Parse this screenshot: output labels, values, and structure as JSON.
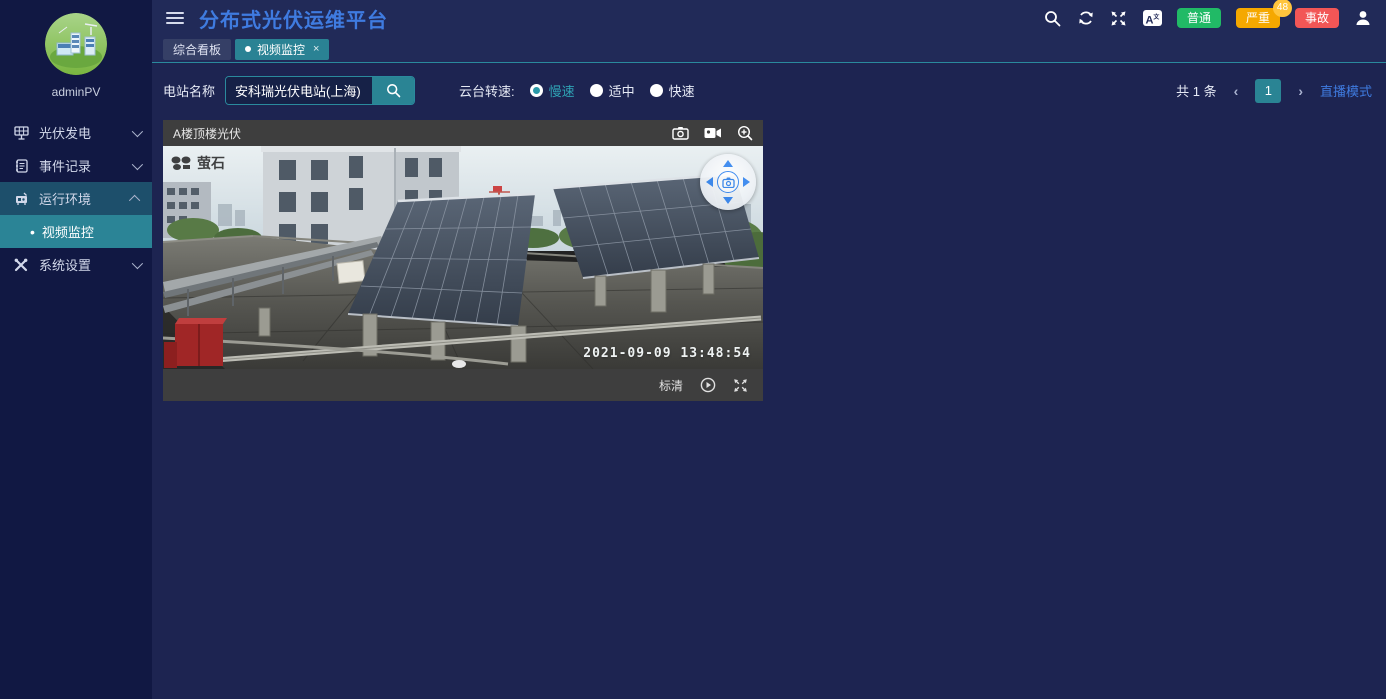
{
  "app": {
    "title": "分布式光伏运维平台",
    "user": "adminPV"
  },
  "colors": {
    "accent_teal": "#2a8494",
    "accent_blue": "#3f7be0",
    "badge_green": "#21ba66",
    "badge_amber": "#f5a800",
    "badge_red": "#f25656",
    "sidebar_bg": "#111843",
    "content_bg": "#1d2451",
    "video_chrome": "#3e3e3e"
  },
  "header": {
    "icons": [
      "menu-icon",
      "search-icon",
      "refresh-icon",
      "fullscreen-icon",
      "translate-icon",
      "user-icon"
    ],
    "translate_label": "A",
    "badges": [
      {
        "label": "普通",
        "count": ""
      },
      {
        "label": "严重",
        "count": "48"
      },
      {
        "label": "事故",
        "count": ""
      }
    ]
  },
  "tabs": [
    {
      "label": "综合看板",
      "active": false
    },
    {
      "label": "视频监控",
      "active": true,
      "close": "×"
    }
  ],
  "sidebar": {
    "items": [
      {
        "label": "光伏发电",
        "icon": "solar-panel-icon",
        "expanded": false
      },
      {
        "label": "事件记录",
        "icon": "event-log-icon",
        "expanded": false
      },
      {
        "label": "运行环境",
        "icon": "environment-icon",
        "expanded": true
      },
      {
        "label": "系统设置",
        "icon": "settings-icon",
        "expanded": false
      }
    ],
    "submenu": [
      {
        "label": "视频监控",
        "bullet": "•",
        "active": true
      }
    ]
  },
  "filter": {
    "station_label": "电站名称",
    "station_value": "安科瑞光伏电站(上海)",
    "speed_label": "云台转速:",
    "speed_options": [
      {
        "label": "慢速",
        "selected": true
      },
      {
        "label": "适中",
        "selected": false
      },
      {
        "label": "快速",
        "selected": false
      }
    ]
  },
  "pagination": {
    "total": "共 1 条",
    "prev": "‹",
    "page": "1",
    "next": "›",
    "live_mode": "直播模式"
  },
  "video": {
    "title": "A楼顶楼光伏",
    "watermark": "萤石",
    "timestamp": "2021-09-09 13:48:54",
    "quality_label": "标清"
  }
}
